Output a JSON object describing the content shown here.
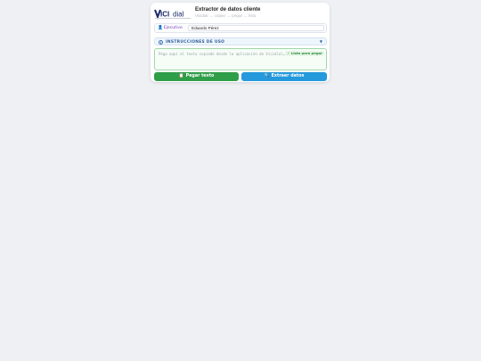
{
  "header": {
    "title": "Extractor de datos cliente",
    "subtitle": "Vicidial → copiar → pegar → listo",
    "logo_text": "VICIdial",
    "logo_icon": "vicidial-logo"
  },
  "agent": {
    "label": "Ejecutivo",
    "icon": "person-icon",
    "value": "Eduardo Pérez"
  },
  "instructions": {
    "label": "INSTRUCCIONES DE USO",
    "icon": "info-icon",
    "chevron": "▼"
  },
  "paste_area": {
    "placeholder": "Pega aquí el texto copiado desde la aplicación de Vicidial…",
    "badge": "Listo para pegar",
    "badge_icon": "✓"
  },
  "buttons": {
    "paste": {
      "label": "Pegar texto",
      "icon": "clipboard-icon"
    },
    "extract": {
      "label": "Extraer datos",
      "icon": "search-icon"
    }
  },
  "colors": {
    "paste_button": "#2f9e49",
    "extract_button": "#2499dc",
    "accent_purple": "#7b3fb8",
    "instructions_blue": "#2f5f9a"
  }
}
